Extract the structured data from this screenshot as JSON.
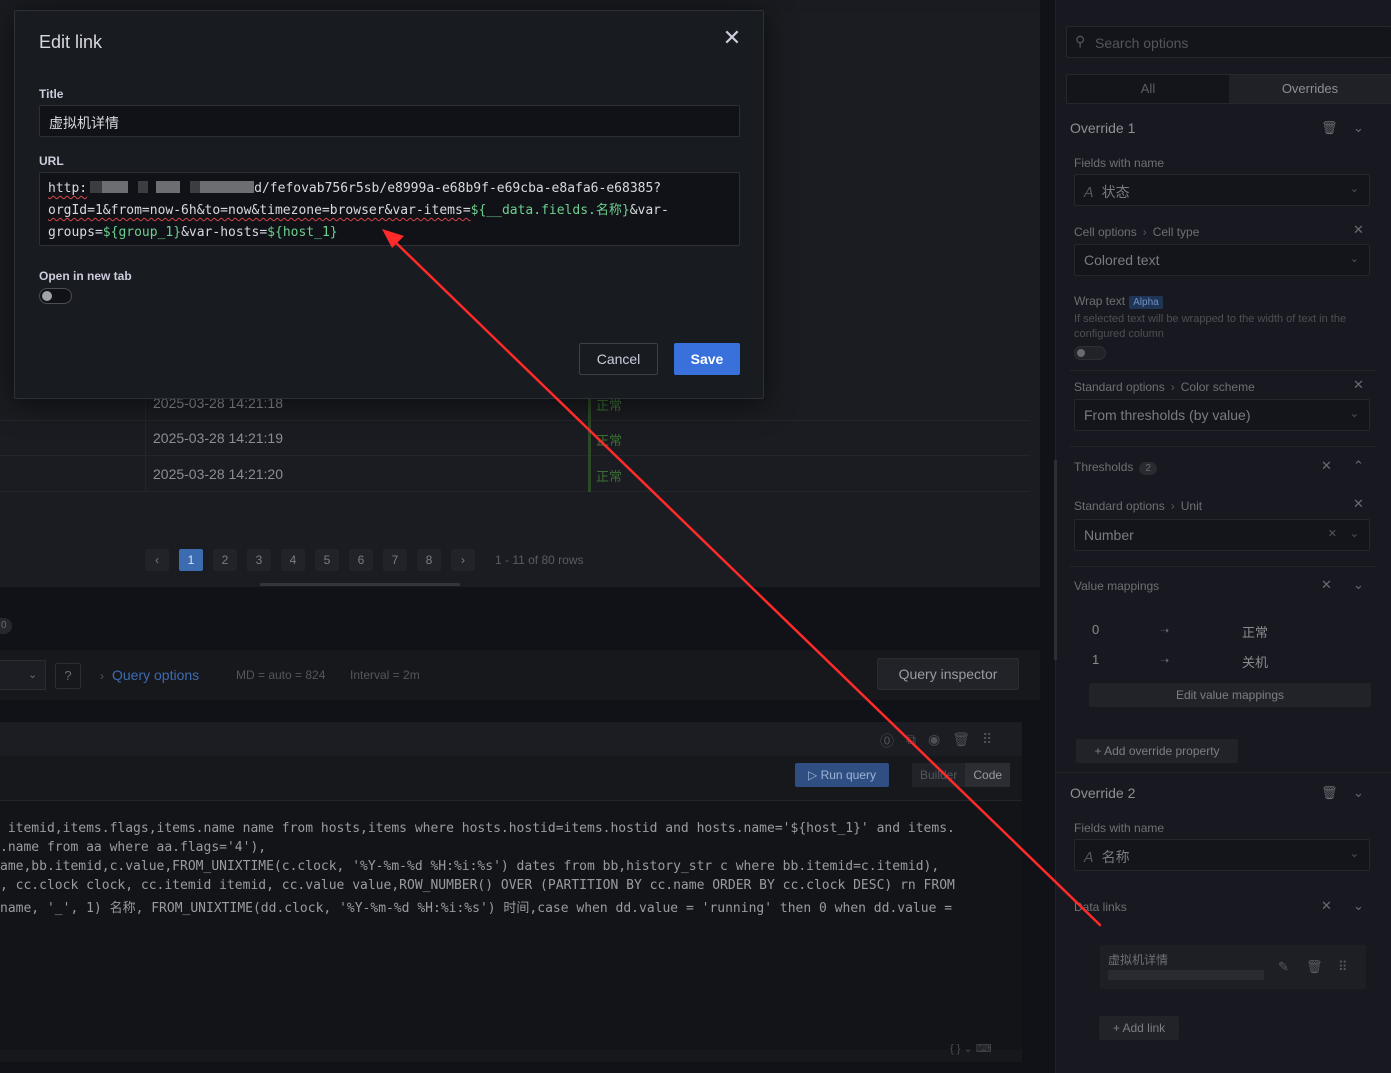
{
  "table": {
    "rows": [
      {
        "date": "2025-03-28 14:21:18",
        "status": "正常"
      },
      {
        "date": "2025-03-28 14:21:19",
        "status": "正常"
      },
      {
        "date": "2025-03-28 14:21:20",
        "status": "正常"
      }
    ],
    "pagination": {
      "prev": "‹",
      "next": "›",
      "pages": [
        "1",
        "2",
        "3",
        "4",
        "5",
        "6",
        "7",
        "8"
      ],
      "active_page": "1",
      "info": "1 - 11 of 80 rows"
    }
  },
  "query_bar": {
    "tab_badge": "0",
    "select_chevron": "⌄",
    "help_icon": "?",
    "query_options_label": "Query options",
    "md_text": "MD = auto = 824",
    "interval_text": "Interval = 2m",
    "inspector_label": "Query inspector"
  },
  "editor": {
    "run_query_label": "▷ Run query",
    "builder_label": "Builder",
    "code_label": "Code",
    "code_lines": [
      " itemid,items.flags,items.name name from hosts,items where hosts.hostid=items.hostid and hosts.name='${host_1}' and items.",
      ".name from aa where aa.flags='4'),",
      "ame,bb.itemid,c.value,FROM_UNIXTIME(c.clock, '%Y-%m-%d %H:%i:%s') dates from bb,history_str c where bb.itemid=c.itemid),",
      ", cc.clock clock, cc.itemid itemid, cc.value value,ROW_NUMBER() OVER (PARTITION BY cc.name ORDER BY cc.clock DESC) rn FROM",
      "name, '_', 1) 名称, FROM_UNIXTIME(dd.clock, '%Y-%m-%d %H:%i:%s') 时间,case when dd.value = 'running' then 0 when dd.value ="
    ],
    "footer": "{ }  ⌄  ⌨"
  },
  "options_pane": {
    "search_placeholder": "Search options",
    "tabs": [
      "All",
      "Overrides"
    ],
    "override1": {
      "title": "Override 1",
      "fields_with_name_label": "Fields with name",
      "fields_with_name_value": "状态",
      "cell_options_label": "Cell options",
      "cell_type_label": "Cell type",
      "cell_type_value": "Colored text",
      "wrap_text_label": "Wrap text",
      "alpha_badge": "Alpha",
      "wrap_text_desc": "If selected text will be wrapped to the width of text in the configured column",
      "standard_options_label": "Standard options",
      "color_scheme_label": "Color scheme",
      "color_scheme_value": "From thresholds (by value)",
      "thresholds_label": "Thresholds",
      "thresholds_count": "2",
      "unit_label": "Unit",
      "unit_value": "Number",
      "value_mappings_label": "Value mappings",
      "mappings": [
        {
          "key": "0",
          "value": "正常"
        },
        {
          "key": "1",
          "value": "关机"
        }
      ],
      "edit_mappings_label": "Edit value mappings",
      "add_override_property_label": "+ Add override property"
    },
    "override2": {
      "title": "Override 2",
      "fields_with_name_label": "Fields with name",
      "fields_with_name_value": "名称",
      "data_links_label": "Data links",
      "link_title": "虚拟机详情",
      "add_link_label": "+ Add link"
    }
  },
  "modal": {
    "title": "Edit link",
    "title_label": "Title",
    "title_value": "虚拟机详情",
    "url_label": "URL",
    "url": {
      "line1_prefix": "http:",
      "line1_suffix": "d/fefovab756r5sb/e8999a-e68b9f-e69cba-e8afa6-e68385?",
      "line2_plain": "orgId=1&from=now-6h&to=now&timezone=browser&var-items=",
      "line2_var": "${__data.fields.名称}",
      "line2_tail": "&var-",
      "line3_a": "groups=",
      "line3_var1": "${group_1}",
      "line3_b": "&var-hosts=",
      "line3_var2": "${host_1}"
    },
    "open_new_tab_label": "Open in new tab",
    "open_new_tab": false,
    "cancel_label": "Cancel",
    "save_label": "Save"
  },
  "colors": {
    "primary": "#3871dc",
    "variable": "#6ccf8e",
    "annotation_arrow": "#ff2a2a"
  }
}
